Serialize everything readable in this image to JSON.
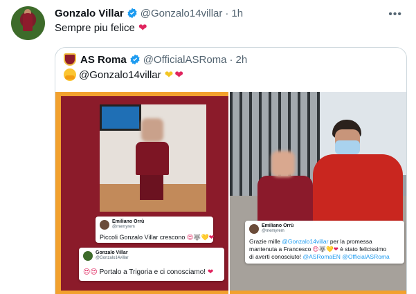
{
  "tweet": {
    "author_name": "Gonzalo Villar",
    "author_handle": "@Gonzalo14villar",
    "separator": "·",
    "time": "1h",
    "text": "Sempre piu felice",
    "more_icon": "more-icon"
  },
  "quote": {
    "author_name": "AS Roma",
    "author_handle": "@OfficialASRoma",
    "separator": "·",
    "time": "2h",
    "mention": "@Gonzalo14villar"
  },
  "left_image": {
    "comment1": {
      "name": "Emiliano Orrù",
      "handle": "@memyrem",
      "text": "Piccoli Gonzalo Villar crescono"
    },
    "comment2": {
      "name": "Gonzalo Villar",
      "handle": "@Gonzalo14villar",
      "text": "Portalo a Trigoria e ci conosciamo!"
    }
  },
  "right_image": {
    "comment": {
      "name": "Emiliano Orrù",
      "handle": "@memyrem",
      "line1_pre": "Grazie mille ",
      "line1_link": "@Gonzalo14villar",
      "line1_post": " per la promessa",
      "line2": "mantenuta a Francesco",
      "line2_post": " è stato felicissimo",
      "line3_pre": "di averti conosciuto! ",
      "line3_link1": "@ASRomaEN",
      "line3_link2": " @OfficialASRoma"
    }
  },
  "colors": {
    "roma_red": "#8e1b2c",
    "roma_orange": "#f2a12e",
    "link": "#1d9bf0",
    "verified": "#1d9bf0"
  }
}
